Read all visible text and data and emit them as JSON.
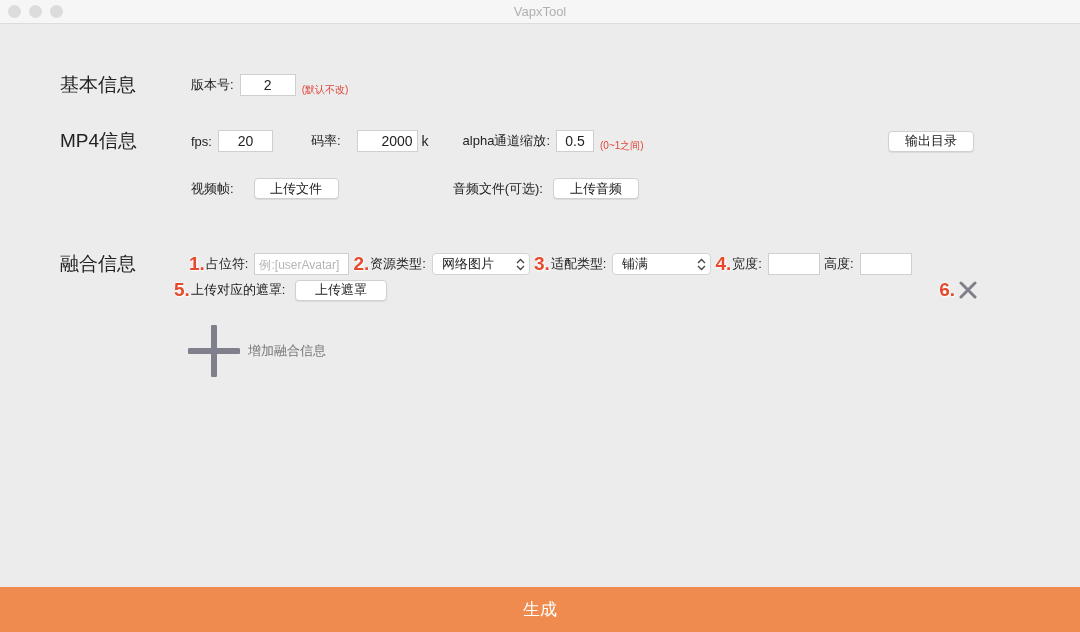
{
  "window": {
    "title": "VapxTool"
  },
  "basic": {
    "heading": "基本信息",
    "version": {
      "label": "版本号:",
      "value": "2",
      "hint": "(默认不改)"
    }
  },
  "mp4": {
    "heading": "MP4信息",
    "fps": {
      "label": "fps:",
      "value": "20"
    },
    "bitrate": {
      "label": "码率:",
      "value": "2000",
      "unit": "k"
    },
    "alpha": {
      "label": "alpha通道缩放:",
      "value": "0.5",
      "hint": "(0~1之间)"
    },
    "output_button": "输出目录",
    "video": {
      "label": "视频帧:",
      "button": "上传文件"
    },
    "audio": {
      "label": "音频文件(可选):",
      "button": "上传音频"
    }
  },
  "fusion": {
    "heading": "融合信息",
    "row_1": [
      {
        "kind": "input",
        "marker": "1.",
        "label": "占位符:",
        "placeholder": "例:[userAvatar]"
      },
      {
        "kind": "select",
        "marker": "2.",
        "label": "资源类型:",
        "value": "网络图片"
      },
      {
        "kind": "select",
        "marker": "3.",
        "label": "适配类型:",
        "value": "铺满"
      },
      {
        "kind": "input",
        "marker": "4.",
        "label": "宽度:"
      },
      {
        "kind": "input",
        "label": "高度:"
      }
    ],
    "row_2": [
      {
        "kind": "button",
        "marker": "5.",
        "label": "上传对应的遮罩:",
        "button": "上传遮罩"
      }
    ],
    "delete_marker": "6.",
    "add_label": "增加融合信息"
  },
  "generate_button": "生成"
}
